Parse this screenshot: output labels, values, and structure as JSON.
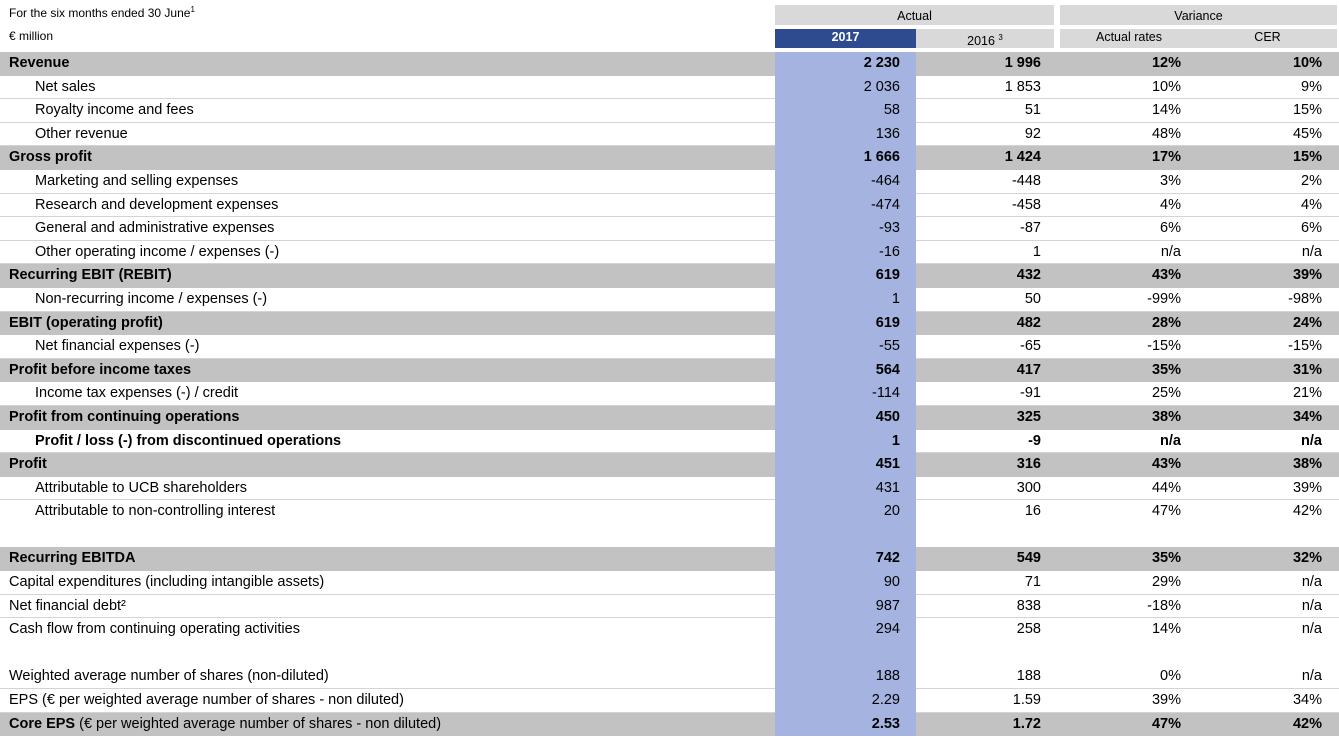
{
  "header": {
    "period_label": "For the six months ended 30 June",
    "period_footnote": "1",
    "unit_label": "€ million",
    "group_actual": "Actual",
    "group_variance": "Variance",
    "col_2017": "2017",
    "col_2016": "2016",
    "col_2016_footnote": "3",
    "col_actual_rates": "Actual rates",
    "col_cer": "CER"
  },
  "rows": [
    {
      "type": "total",
      "label": "Revenue",
      "v2017": "2 230",
      "v2016": "1 996",
      "actual": "12%",
      "cer": "10%"
    },
    {
      "type": "line",
      "indent": true,
      "label": "Net sales",
      "v2017": "2 036",
      "v2016": "1 853",
      "actual": "10%",
      "cer": "9%"
    },
    {
      "type": "line",
      "indent": true,
      "label": "Royalty income and fees",
      "v2017": "58",
      "v2016": "51",
      "actual": "14%",
      "cer": "15%"
    },
    {
      "type": "line",
      "indent": true,
      "label": "Other revenue",
      "v2017": "136",
      "v2016": "92",
      "actual": "48%",
      "cer": "45%"
    },
    {
      "type": "total",
      "label": "Gross profit",
      "v2017": "1 666",
      "v2016": "1 424",
      "actual": "17%",
      "cer": "15%"
    },
    {
      "type": "line",
      "indent": true,
      "label": "Marketing and selling expenses",
      "v2017": "-464",
      "v2016": "-448",
      "actual": "3%",
      "cer": "2%"
    },
    {
      "type": "line",
      "indent": true,
      "label": "Research and development expenses",
      "v2017": "-474",
      "v2016": "-458",
      "actual": "4%",
      "cer": "4%"
    },
    {
      "type": "line",
      "indent": true,
      "label": "General and administrative expenses",
      "v2017": "-93",
      "v2016": "-87",
      "actual": "6%",
      "cer": "6%"
    },
    {
      "type": "line",
      "indent": true,
      "label": "Other operating income / expenses (-)",
      "v2017": "-16",
      "v2016": "1",
      "actual": "n/a",
      "cer": "n/a"
    },
    {
      "type": "total",
      "label": "Recurring EBIT (REBIT)",
      "v2017": "619",
      "v2016": "432",
      "actual": "43%",
      "cer": "39%"
    },
    {
      "type": "line",
      "indent": true,
      "label": "Non-recurring income / expenses (-)",
      "v2017": "1",
      "v2016": "50",
      "actual": "-99%",
      "cer": "-98%"
    },
    {
      "type": "total",
      "label": "EBIT (operating profit)",
      "v2017": "619",
      "v2016": "482",
      "actual": "28%",
      "cer": "24%"
    },
    {
      "type": "line",
      "indent": true,
      "label": "Net financial expenses (-)",
      "v2017": "-55",
      "v2016": "-65",
      "actual": "-15%",
      "cer": "-15%"
    },
    {
      "type": "total",
      "label": "Profit before income taxes",
      "v2017": "564",
      "v2016": "417",
      "actual": "35%",
      "cer": "31%"
    },
    {
      "type": "line",
      "indent": true,
      "label": "Income tax expenses (-) / credit",
      "v2017": "-114",
      "v2016": "-91",
      "actual": "25%",
      "cer": "21%"
    },
    {
      "type": "total",
      "label": "Profit from continuing operations",
      "v2017": "450",
      "v2016": "325",
      "actual": "38%",
      "cer": "34%"
    },
    {
      "type": "boldline",
      "indent": true,
      "label": "Profit / loss (-) from discontinued operations",
      "v2017": "1",
      "v2016": "-9",
      "actual": "n/a",
      "cer": "n/a"
    },
    {
      "type": "total",
      "label": "Profit",
      "v2017": "451",
      "v2016": "316",
      "actual": "43%",
      "cer": "38%"
    },
    {
      "type": "line",
      "indent": true,
      "label": "Attributable to UCB shareholders",
      "v2017": "431",
      "v2016": "300",
      "actual": "44%",
      "cer": "39%"
    },
    {
      "type": "plain",
      "indent": true,
      "label": "Attributable to non-controlling interest",
      "v2017": "20",
      "v2016": "16",
      "actual": "47%",
      "cer": "42%"
    },
    {
      "type": "blank"
    },
    {
      "type": "total",
      "label": "Recurring EBITDA",
      "v2017": "742",
      "v2016": "549",
      "actual": "35%",
      "cer": "32%"
    },
    {
      "type": "line",
      "indent": false,
      "label": "Capital expenditures (including intangible assets)",
      "v2017": "90",
      "v2016": "71",
      "actual": "29%",
      "cer": "n/a"
    },
    {
      "type": "line",
      "indent": false,
      "label": "Net financial debt²",
      "v2017": "987",
      "v2016": "838",
      "actual": "-18%",
      "cer": "n/a"
    },
    {
      "type": "plain",
      "indent": false,
      "label": "Cash flow from continuing operating activities",
      "v2017": "294",
      "v2016": "258",
      "actual": "14%",
      "cer": "n/a"
    },
    {
      "type": "blank"
    },
    {
      "type": "line",
      "indent": false,
      "label": "Weighted average number of shares (non-diluted)",
      "v2017": "188",
      "v2016": "188",
      "actual": "0%",
      "cer": "n/a"
    },
    {
      "type": "line",
      "indent": false,
      "label": "EPS (€ per weighted average number of shares - non diluted)",
      "v2017": "2.29",
      "v2016": "1.59",
      "actual": "39%",
      "cer": "34%"
    },
    {
      "type": "total",
      "label": "Core EPS",
      "label_suffix": " (€ per weighted average number of shares - non diluted)",
      "v2017": "2.53",
      "v2016": "1.72",
      "actual": "47%",
      "cer": "42%"
    }
  ]
}
